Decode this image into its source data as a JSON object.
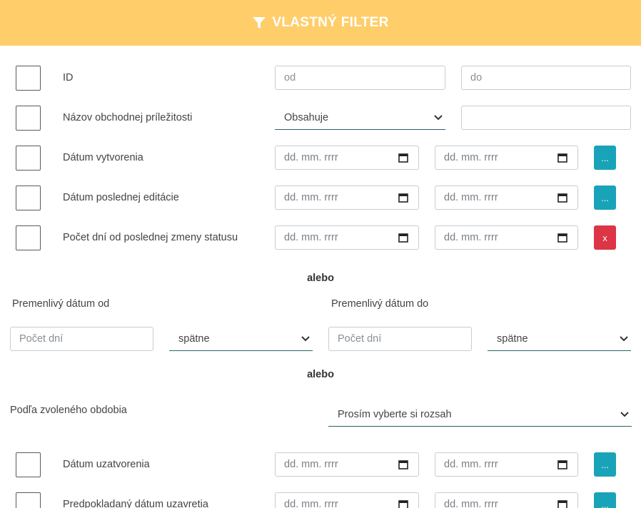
{
  "header": {
    "title": "VLASTNÝ FILTER",
    "icon": "filter-icon",
    "bg": "#ffcd6a"
  },
  "rows": [
    {
      "label": "ID",
      "from_placeholder": "od",
      "to_placeholder": "do"
    },
    {
      "label": "Názov obchodnej príležitosti",
      "select_value": "Obsahuje",
      "text_value": ""
    },
    {
      "label": "Dátum vytvorenia",
      "from": "dd. mm. rrrr",
      "to": "dd. mm. rrrr",
      "button": "..."
    },
    {
      "label": "Dátum poslednej editácie",
      "from": "dd. mm. rrrr",
      "to": "dd. mm. rrrr",
      "button": "..."
    },
    {
      "label": "Počet dní od poslednej zmeny statusu",
      "from": "dd. mm. rrrr",
      "to": "dd. mm. rrrr",
      "button": "x"
    }
  ],
  "or_label": "alebo",
  "variable": {
    "from_label": "Premenlivý dátum od",
    "to_label": "Premenlivý dátum do",
    "days_placeholder": "Počet dní",
    "direction": "spätne"
  },
  "period": {
    "label": "Podľa zvoleného obdobia",
    "select_value": "Prosím vyberte si rozsah"
  },
  "rows2": [
    {
      "label": "Dátum uzatvorenia",
      "from": "dd. mm. rrrr",
      "to": "dd. mm. rrrr",
      "button": "..."
    },
    {
      "label": "Predpokladaný dátum uzavretia",
      "from": "dd. mm. rrrr",
      "to": "dd. mm. rrrr",
      "button": "..."
    }
  ],
  "colors": {
    "info": "#19a3b8",
    "danger": "#dc3545",
    "select_underline": "#2d5f6a"
  }
}
